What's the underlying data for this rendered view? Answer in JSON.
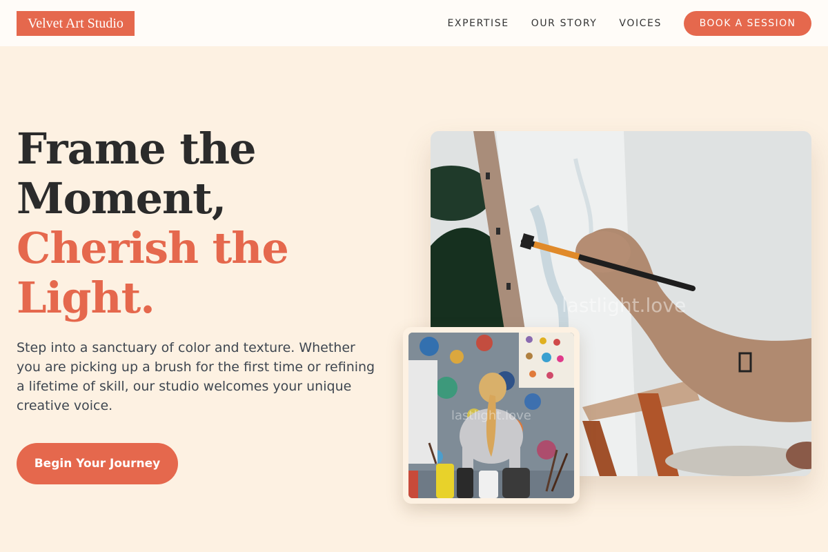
{
  "header": {
    "logo": "Velvet Art Studio",
    "nav": [
      {
        "label": "EXPERTISE"
      },
      {
        "label": "OUR STORY"
      },
      {
        "label": "VOICES"
      }
    ],
    "cta_label": "BOOK A SESSION"
  },
  "hero": {
    "title_line1": "Frame the",
    "title_line2": "Moment,",
    "title_line3": "Cherish the",
    "title_line4": "Light.",
    "description": "Step into a sanctuary of color and texture. Whether you are picking up a brush for the first time or refining a lifetime of skill, our studio welcomes your unique creative voice.",
    "cta_label": "Begin Your Journey"
  },
  "images": {
    "main_watermark": "lastlight.love",
    "inset_watermark": "lastlight.love"
  },
  "colors": {
    "accent": "#e5684d",
    "background": "#fdf1e2",
    "header_background": "#fffcf8",
    "heading_dark": "#2b2b2b",
    "body_text": "#3e4650"
  },
  "icons": {
    "main_image": "painting-hand-photo",
    "inset_image": "child-painting-photo"
  }
}
